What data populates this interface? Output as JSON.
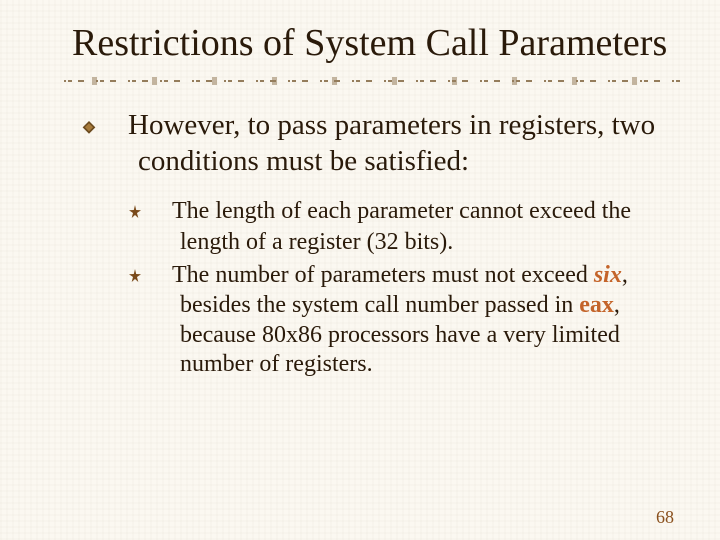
{
  "title": "Restrictions of System Call Parameters",
  "bullets": {
    "p1": "However, to pass parameters in registers, two conditions must be satisfied:",
    "c1": "The length of each parameter cannot exceed the length of a register (32 bits).",
    "c2a": "The number of parameters must not exceed ",
    "c2_six": "six",
    "c2b": ", besides the system call number passed in ",
    "c2_eax": "eax",
    "c2c": ", because 80x86 processors have a very limited number of registers."
  },
  "page_number": "68",
  "colors": {
    "accent": "#c4642a",
    "rule": "#6b4a1e",
    "bg": "#fbf8f1"
  }
}
